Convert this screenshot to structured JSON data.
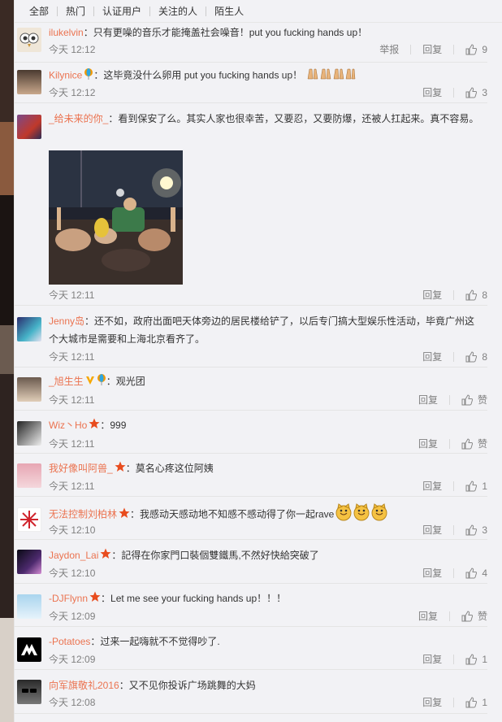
{
  "tabs": [
    "全部",
    "热门",
    "认证用户",
    "关注的人",
    "陌生人"
  ],
  "actions": {
    "report": "举报",
    "reply": "回复",
    "like_empty": "赞"
  },
  "comments": [
    {
      "user": "ilukelvin",
      "text": "：只有更噪的音乐才能掩盖社会噪音！put you fucking hands up！",
      "time": "今天 12:12",
      "likes": "9",
      "avatar": "owl-avatar"
    },
    {
      "user": "Kilynice",
      "text": "：这毕竟没什么卵用 put you fucking hands up！",
      "time": "今天 12:12",
      "likes": "3",
      "avatar": "girl-avatar"
    },
    {
      "user": "_给未来的你_",
      "text": "：看到保安了么。其实人家也很幸苦，又要忍，又要防爆，还被人扛起来。真不容易。",
      "time": "今天 12:11",
      "likes": "8",
      "avatar": "crowd-avatar"
    },
    {
      "user": "Jenny岛",
      "text": "：还不如，政府出面吧天体旁边的居民楼给铲了，以后专门搞大型娱乐性活动，毕竟广州这个大城市是需要和上海北京看齐了。",
      "time": "今天 12:11",
      "likes": "8",
      "avatar": "anime-avatar"
    },
    {
      "user": "_旭生生",
      "text": "：观光团",
      "time": "今天 12:11",
      "likes": "赞",
      "avatar": "boy-avatar"
    },
    {
      "user": "Wiz丶Ho",
      "text": "：999",
      "time": "今天 12:11",
      "likes": "赞",
      "avatar": "bw-avatar"
    },
    {
      "user": "我好像叫阿兽_",
      "text": "：莫名心疼这位阿姨",
      "time": "今天 12:11",
      "likes": "1",
      "avatar": "pink-avatar"
    },
    {
      "user": "无法控制刘柏林",
      "text": "：我感动天感动地不知感不感动得了你一起rave",
      "time": "今天 12:10",
      "likes": "3",
      "avatar": "red-avatar"
    },
    {
      "user": "Jaydon_Lai",
      "text": "：記得在你家門口裝個雙鐵馬,不然好快給突破了",
      "time": "今天 12:10",
      "likes": "4",
      "avatar": "stage-avatar"
    },
    {
      "user": "-DJFlynn",
      "text": "：Let me see your fucking hands up！！！",
      "time": "今天 12:09",
      "likes": "赞",
      "avatar": "sky-avatar"
    },
    {
      "user": "-Potatoes",
      "text": "：过来一起嗨就不不觉得吵了.",
      "time": "今天 12:09",
      "likes": "1",
      "avatar": "avicii-avatar"
    },
    {
      "user": "向军旗敬礼2016",
      "text": "：又不见你投诉广场跳舞的大妈",
      "time": "今天 12:08",
      "likes": "1",
      "avatar": "sunglasses-avatar"
    }
  ],
  "colors": {
    "username": "#eb7350",
    "text": "#333333",
    "meta": "#808080",
    "background": "#f2f2f5"
  }
}
